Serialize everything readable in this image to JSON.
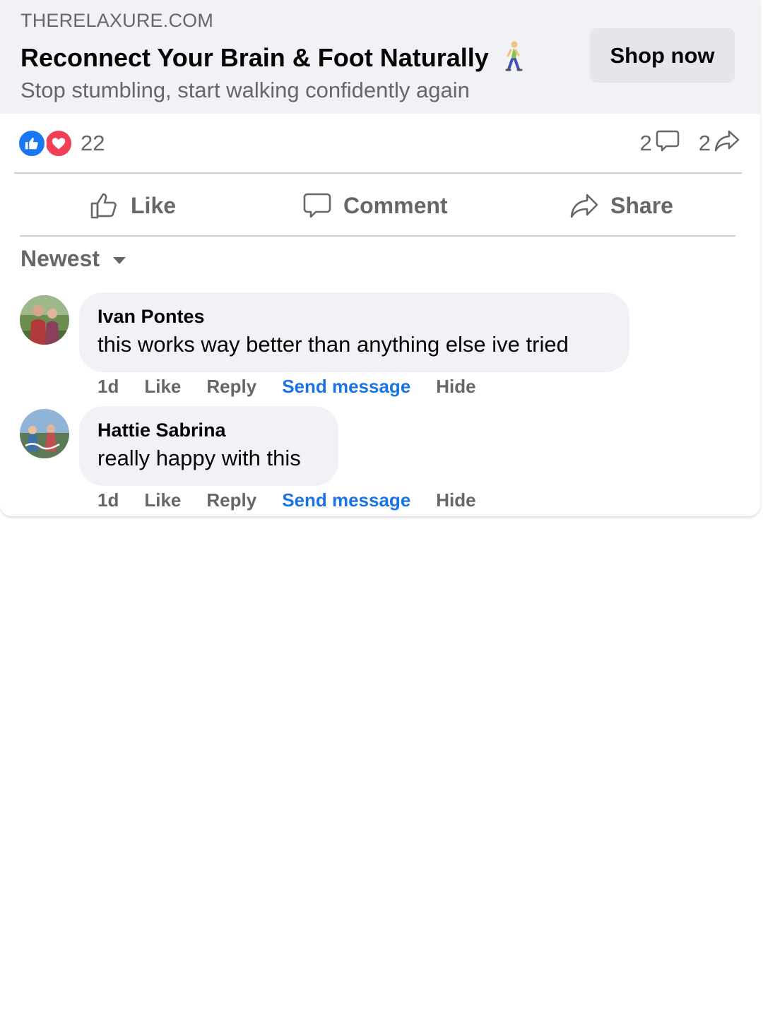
{
  "ad": {
    "domain": "THERELAXURE.COM",
    "headline": "Reconnect Your Brain & Foot Naturally",
    "headline_emoji": "person-walking-icon",
    "subline": "Stop stumbling, start walking confidently again",
    "cta_label": "Shop now"
  },
  "stats": {
    "reactions": [
      "like-reaction-icon",
      "love-reaction-icon"
    ],
    "reaction_count": "22",
    "comment_count": "2",
    "share_count": "2"
  },
  "actions": {
    "like_label": "Like",
    "comment_label": "Comment",
    "share_label": "Share"
  },
  "sort": {
    "label": "Newest"
  },
  "comments": [
    {
      "author": "Ivan Pontes",
      "text": "this works way better than anything else ive tried",
      "time": "1d",
      "like_label": "Like",
      "reply_label": "Reply",
      "message_label": "Send message",
      "hide_label": "Hide"
    },
    {
      "author": "Hattie Sabrina",
      "text": "really happy with this",
      "time": "1d",
      "like_label": "Like",
      "reply_label": "Reply",
      "message_label": "Send message",
      "hide_label": "Hide"
    }
  ],
  "colors": {
    "link_blue": "#1b74e4",
    "like_blue": "#1877f2",
    "love_red": "#f33e58",
    "secondary_text": "#65676b",
    "banner_bg": "#f0f2f5",
    "button_bg": "#e4e6eb"
  }
}
